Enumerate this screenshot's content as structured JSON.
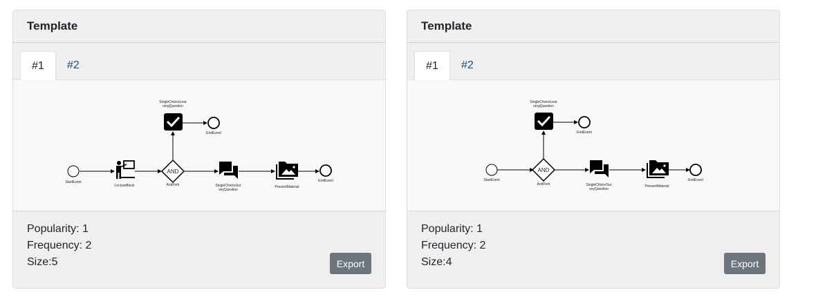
{
  "cards": [
    {
      "title": "Template",
      "tabs": [
        "#1",
        "#2"
      ],
      "active_tab": "#1",
      "diagram": {
        "labels": {
          "start": "StartEvent",
          "lecture": "LectureBlock",
          "andfork": "AndFork",
          "andlabel": "AND",
          "survey_line1": "SingleChoiceSur",
          "survey_line2": "veyQuestion",
          "present": "PresentMaterial",
          "end_main": "EndEvent",
          "learn_line1": "SingleChoiceLear",
          "learn_line2": "ningQuestion",
          "end_top": "EndEvent"
        }
      },
      "stats": {
        "popularity": "Popularity: 1",
        "frequency": "Frequency: 2",
        "size": "Size:5"
      },
      "export_label": "Export"
    },
    {
      "title": "Template",
      "tabs": [
        "#1",
        "#2"
      ],
      "active_tab": "#1",
      "diagram": {
        "labels": {
          "start": "StartEvent",
          "andfork": "AndFork",
          "andlabel": "AND",
          "survey_line1": "SingleChoiceSur",
          "survey_line2": "veyQuestion",
          "present": "PresentMaterial",
          "end_main": "EndEvent",
          "learn_line1": "SingleChoiceLear",
          "learn_line2": "ningQuestion",
          "end_top": "EndEvent"
        }
      },
      "stats": {
        "popularity": "Popularity: 1",
        "frequency": "Frequency: 2",
        "size": "Size:4"
      },
      "export_label": "Export"
    }
  ]
}
